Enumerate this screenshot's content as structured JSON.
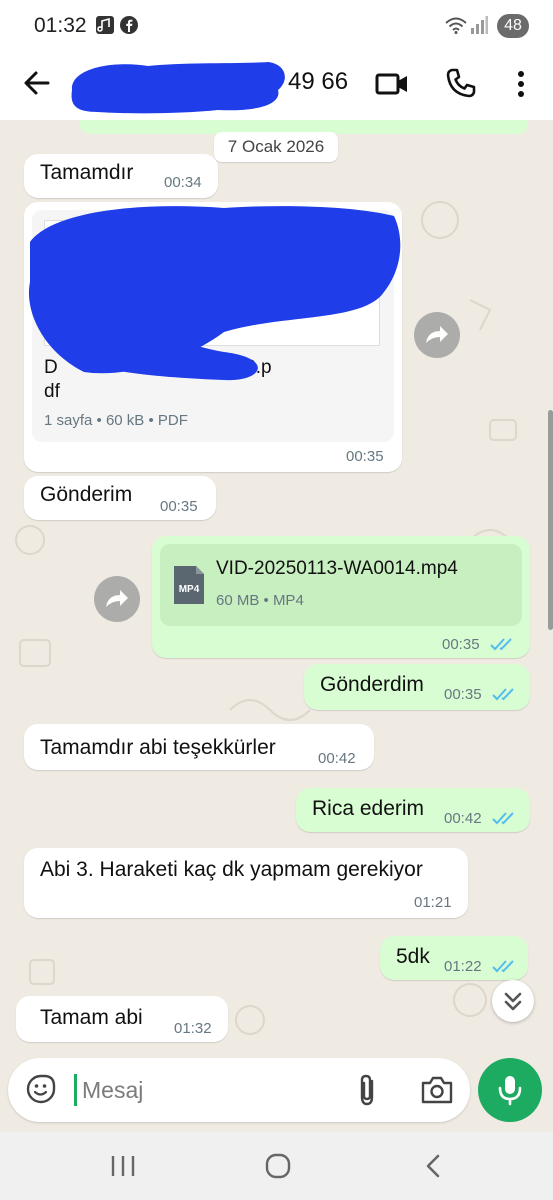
{
  "status_bar": {
    "time": "01:32",
    "battery": "48"
  },
  "header": {
    "contact_number_visible": "49 66"
  },
  "chat": {
    "date_chip": "7 Ocak 2026",
    "messages": [
      {
        "dir": "in",
        "text": "Tamamdır",
        "time": "00:34"
      },
      {
        "dir": "in",
        "type": "document",
        "name_prefix": "D",
        "name_suffix": "8493828.p",
        "name_line2": "df",
        "meta": "1 sayfa • 60 kB • PDF",
        "time": "00:35"
      },
      {
        "dir": "in",
        "text": "Gönderim",
        "time": "00:35"
      },
      {
        "dir": "out",
        "type": "file",
        "name": "VID-20250113-WA0014.mp4",
        "meta": "60 MB • MP4",
        "icon_label": "MP4",
        "time": "00:35"
      },
      {
        "dir": "out",
        "text": "Gönderdim",
        "time": "00:35"
      },
      {
        "dir": "in",
        "text": "Tamamdır abi teşekkürler",
        "time": "00:42"
      },
      {
        "dir": "out",
        "text": "Rica ederim",
        "time": "00:42"
      },
      {
        "dir": "in",
        "text": "Abi 3. Haraketi kaç dk yapmam gerekiyor",
        "time": "01:21"
      },
      {
        "dir": "out",
        "text": "5dk",
        "time": "01:22"
      },
      {
        "dir": "in",
        "text": "Tamam abi",
        "time": "01:32"
      }
    ]
  },
  "composer": {
    "placeholder": "Mesaj"
  },
  "colors": {
    "accent": "#1daa61",
    "outgoing_bubble": "#d9fdd3",
    "incoming_bubble": "#ffffff",
    "read_ticks": "#53bdeb",
    "wallpaper": "#efeae2"
  }
}
